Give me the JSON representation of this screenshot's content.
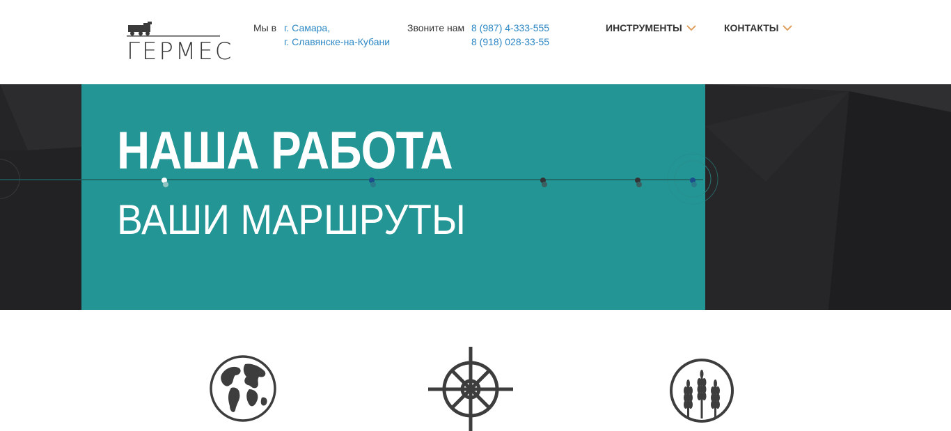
{
  "header": {
    "logo_text": "ГЕРМЕС",
    "location": {
      "label": "Мы в",
      "cities": [
        "г. Самара,",
        "г. Славянске-на-Кубани"
      ]
    },
    "contact": {
      "label": "Звоните нам",
      "phones": [
        "8 (987) 4-333-555",
        "8 (918) 028-33-55"
      ]
    },
    "nav": [
      {
        "label": "ИНСТРУМЕНТЫ",
        "icon": "chevron-down-icon"
      },
      {
        "label": "КОНТАКТЫ",
        "icon": "chevron-down-icon"
      }
    ]
  },
  "hero": {
    "title": "НАША РАБОТА",
    "subtitle": "ВАШИ МАРШРУТЫ",
    "slider_dots": 5
  },
  "features": [
    {
      "icon": "globe-icon"
    },
    {
      "icon": "ship-wheel-icon"
    },
    {
      "icon": "wheat-icon"
    }
  ],
  "colors": {
    "accent_teal": "#229594",
    "link_blue": "#2b87c3",
    "chevron_orange": "#e0a060",
    "dark_bg": "#252527",
    "icon_dark": "#3d3d3d"
  }
}
